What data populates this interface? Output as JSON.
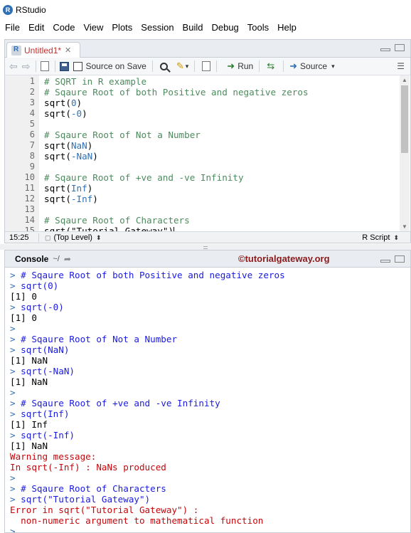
{
  "window": {
    "title": "RStudio",
    "icon_letter": "R"
  },
  "menu": [
    "File",
    "Edit",
    "Code",
    "View",
    "Plots",
    "Session",
    "Build",
    "Debug",
    "Tools",
    "Help"
  ],
  "editor": {
    "tab_label": "Untitled1*",
    "toolbar": {
      "source_on_save": "Source on Save",
      "run": "Run",
      "source": "Source"
    },
    "line_numbers": [
      "1",
      "2",
      "3",
      "4",
      "5",
      "6",
      "7",
      "8",
      "9",
      "10",
      "11",
      "12",
      "13",
      "14",
      "15"
    ],
    "lines": [
      [
        {
          "t": "# SQRT in R example",
          "k": "comment"
        }
      ],
      [
        {
          "t": "# Sqaure Root of both Positive and negative zeros",
          "k": "comment"
        }
      ],
      [
        {
          "t": "sqrt",
          "k": "fn"
        },
        {
          "t": "(",
          "k": "paren"
        },
        {
          "t": "0",
          "k": "arg"
        },
        {
          "t": ")",
          "k": "paren"
        }
      ],
      [
        {
          "t": "sqrt",
          "k": "fn"
        },
        {
          "t": "(",
          "k": "paren"
        },
        {
          "t": "-0",
          "k": "arg"
        },
        {
          "t": ")",
          "k": "paren"
        }
      ],
      [],
      [
        {
          "t": "# Sqaure Root of Not a Number",
          "k": "comment"
        }
      ],
      [
        {
          "t": "sqrt",
          "k": "fn"
        },
        {
          "t": "(",
          "k": "paren"
        },
        {
          "t": "NaN",
          "k": "arg"
        },
        {
          "t": ")",
          "k": "paren"
        }
      ],
      [
        {
          "t": "sqrt",
          "k": "fn"
        },
        {
          "t": "(",
          "k": "paren"
        },
        {
          "t": "-NaN",
          "k": "arg"
        },
        {
          "t": ")",
          "k": "paren"
        }
      ],
      [],
      [
        {
          "t": "# Sqaure Root of +ve and -ve Infinity",
          "k": "comment"
        }
      ],
      [
        {
          "t": "sqrt",
          "k": "fn"
        },
        {
          "t": "(",
          "k": "paren"
        },
        {
          "t": "Inf",
          "k": "arg"
        },
        {
          "t": ")",
          "k": "paren"
        }
      ],
      [
        {
          "t": "sqrt",
          "k": "fn"
        },
        {
          "t": "(",
          "k": "paren"
        },
        {
          "t": "-Inf",
          "k": "arg"
        },
        {
          "t": ")",
          "k": "paren"
        }
      ],
      [],
      [
        {
          "t": "# Sqaure Root of Characters",
          "k": "comment"
        }
      ],
      [
        {
          "t": "sqrt",
          "k": "fn"
        },
        {
          "t": "(",
          "k": "paren"
        },
        {
          "t": "\"Tutorial Gateway\"",
          "k": "fn"
        },
        {
          "t": ")",
          "k": "paren"
        }
      ]
    ],
    "status": {
      "position": "15:25",
      "scope": "(Top Level)",
      "language": "R Script"
    }
  },
  "console": {
    "title": "Console",
    "path": "~/",
    "watermark": "©tutorialgateway.org",
    "lines": [
      {
        "p": "> ",
        "t": "# Sqaure Root of both Positive and negative zeros",
        "k": "input"
      },
      {
        "p": "> ",
        "t": "sqrt(0)",
        "k": "input"
      },
      {
        "p": "",
        "t": "[1] 0",
        "k": "output"
      },
      {
        "p": "> ",
        "t": "sqrt(-0)",
        "k": "input"
      },
      {
        "p": "",
        "t": "[1] 0",
        "k": "output"
      },
      {
        "p": "> ",
        "t": "",
        "k": "input"
      },
      {
        "p": "> ",
        "t": "# Sqaure Root of Not a Number",
        "k": "input"
      },
      {
        "p": "> ",
        "t": "sqrt(NaN)",
        "k": "input"
      },
      {
        "p": "",
        "t": "[1] NaN",
        "k": "output"
      },
      {
        "p": "> ",
        "t": "sqrt(-NaN)",
        "k": "input"
      },
      {
        "p": "",
        "t": "[1] NaN",
        "k": "output"
      },
      {
        "p": "> ",
        "t": "",
        "k": "input"
      },
      {
        "p": "> ",
        "t": "# Sqaure Root of +ve and -ve Infinity",
        "k": "input"
      },
      {
        "p": "> ",
        "t": "sqrt(Inf)",
        "k": "input"
      },
      {
        "p": "",
        "t": "[1] Inf",
        "k": "output"
      },
      {
        "p": "> ",
        "t": "sqrt(-Inf)",
        "k": "input"
      },
      {
        "p": "",
        "t": "[1] NaN",
        "k": "output"
      },
      {
        "p": "",
        "t": "Warning message:",
        "k": "error"
      },
      {
        "p": "",
        "t": "In sqrt(-Inf) : NaNs produced",
        "k": "error"
      },
      {
        "p": "> ",
        "t": "",
        "k": "input"
      },
      {
        "p": "> ",
        "t": "# Sqaure Root of Characters",
        "k": "input"
      },
      {
        "p": "> ",
        "t": "sqrt(\"Tutorial Gateway\")",
        "k": "input"
      },
      {
        "p": "",
        "t": "Error in sqrt(\"Tutorial Gateway\") :",
        "k": "error"
      },
      {
        "p": "",
        "t": "  non-numeric argument to mathematical function",
        "k": "error"
      },
      {
        "p": "> ",
        "t": "",
        "k": "input"
      }
    ]
  },
  "colors": {
    "comment": "#4d8a5e",
    "argument": "#2f6fb4",
    "console_input": "#1a1ae0",
    "console_error": "#c5060b",
    "watermark": "#8b1a1a"
  }
}
